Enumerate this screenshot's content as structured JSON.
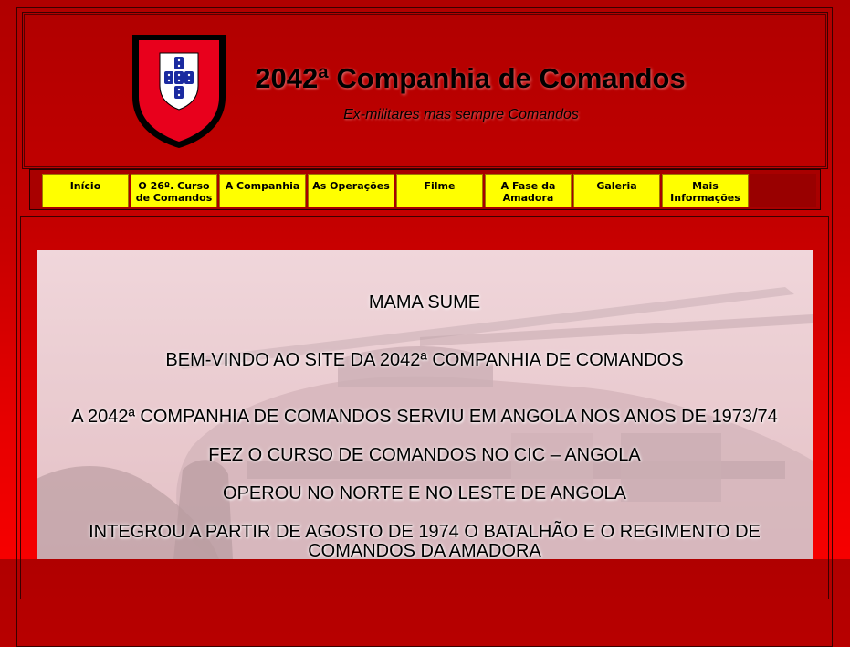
{
  "header": {
    "title": "2042ª Companhia de Comandos",
    "subtitle": "Ex-militares mas sempre Comandos",
    "logo_icon": "commando-shield-icon"
  },
  "nav": {
    "items": [
      {
        "label": "Início"
      },
      {
        "label": "O 26º. Curso de Comandos"
      },
      {
        "label": "A Companhia"
      },
      {
        "label": "As Operações"
      },
      {
        "label": "Filme"
      },
      {
        "label": "A Fase da Amadora"
      },
      {
        "label": "Galeria"
      },
      {
        "label": "Mais Informações"
      }
    ]
  },
  "content": {
    "background": "helicopter-photo",
    "lines": [
      "MAMA SUME",
      "BEM-VINDO AO SITE DA 2042ª COMPANHIA DE COMANDOS",
      "A 2042ª COMPANHIA DE COMANDOS SERVIU EM ANGOLA NOS ANOS DE 1973/74",
      "FEZ O CURSO DE COMANDOS NO CIC – ANGOLA",
      "OPEROU NO NORTE E NO LESTE DE ANGOLA",
      "INTEGROU A PARTIR DE AGOSTO DE 1974 O BATALHÃO E O REGIMENTO DE",
      "COMANDOS DA AMADORA"
    ]
  },
  "colors": {
    "page_background": "#c40000",
    "nav_button": "#ffff00",
    "shield_red": "#e8001c",
    "shield_border": "#000000"
  }
}
